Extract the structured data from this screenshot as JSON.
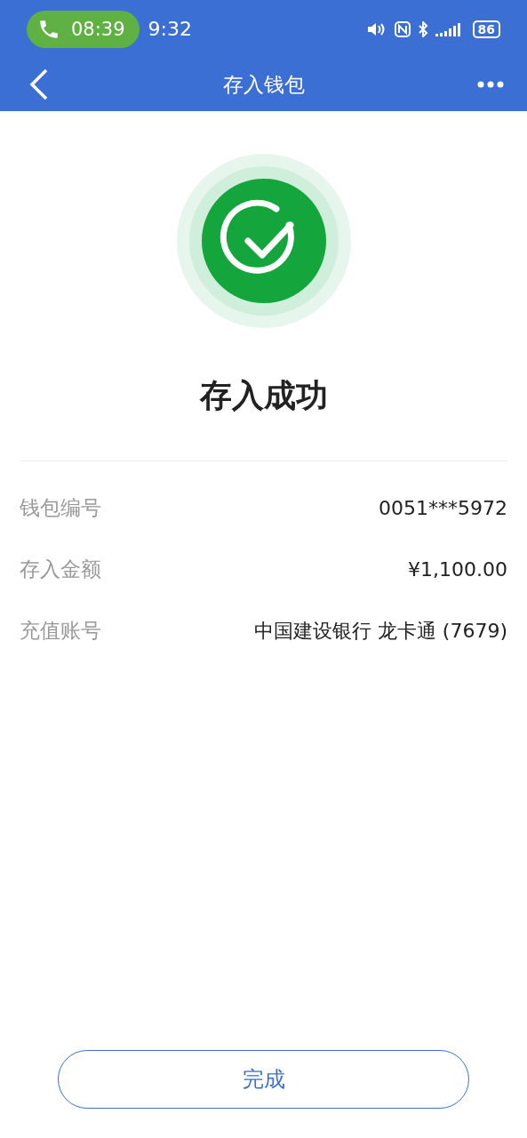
{
  "status_bar": {
    "call_time": "08:39",
    "clock": "9:32",
    "battery": "86"
  },
  "nav_bar": {
    "title": "存入钱包"
  },
  "result": {
    "kind": "success",
    "title": "存入成功"
  },
  "details": [
    {
      "label": "钱包编号",
      "value": "0051***5972"
    },
    {
      "label": "存入金额",
      "value": "¥1,100.00"
    },
    {
      "label": "充值账号",
      "value": "中国建设银行 龙卡通 (7679)"
    }
  ],
  "buttons": [
    {
      "label": "完成"
    }
  ]
}
